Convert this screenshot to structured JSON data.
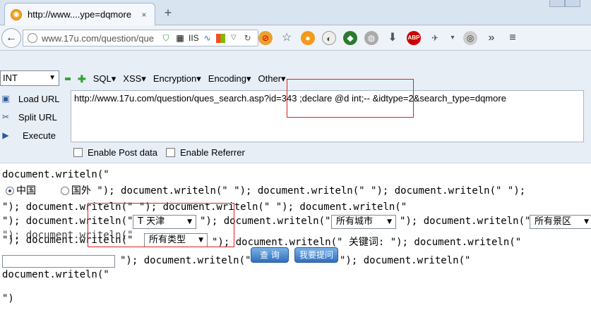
{
  "tab": {
    "title": "http://www....ype=dqmore",
    "close": "×",
    "new_tab": "+"
  },
  "nav": {
    "back": "←",
    "url": "www.17u.com/question/que",
    "iis": "IIS"
  },
  "hackbar": {
    "select_value": "INT",
    "menu": [
      "SQL",
      "XSS",
      "Encryption",
      "Encoding",
      "Other"
    ],
    "load_url": "Load URL",
    "split_url": "Split URL",
    "execute": "Execute",
    "url_value": "http://www.17u.com/question/ques_search.asp?id=343 ;declare @d int;-- &idtype=2&search_type=dqmore",
    "enable_post": "Enable Post data",
    "enable_referrer": "Enable Referrer"
  },
  "page": {
    "line1": "document.writeln(\"",
    "radio_china": "中国",
    "radio_foreign": "国外",
    "line2_rest": " \"); document.writeln(\" \"); document.writeln(\" \"); document.writeln(\" \");",
    "line3": "\"); document.writeln(\" \"); document.writeln(\" \"); document.writeln(\"",
    "line4a": "\"); document.writeln(\"",
    "city_select": "天津",
    "line4b": "\"); document.writeln(\"",
    "all_cities": "所有城市",
    "line4c": "\"); document.writeln(\"",
    "all_scenic": "所有景区",
    "line5a": "\"); document.writeln(\"",
    "all_types": "所有类型",
    "line5b": "\"); document.writeln(\" 关键词: \"); document.writeln(\"",
    "line6a": "\"); document.writeln(\"",
    "search_button": "查 询",
    "ask_button": "我要提问",
    "line6b": "\"); document.writeln(\"",
    "line7": "document.writeln(\"",
    "line8": "\")"
  }
}
